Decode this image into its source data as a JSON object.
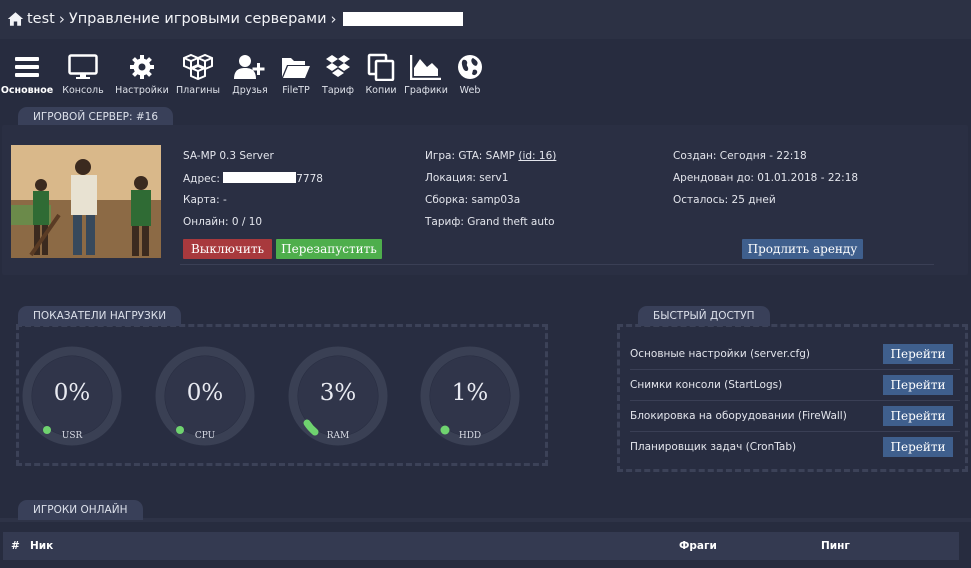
{
  "breadcrumb": {
    "root": "test",
    "section": "Управление игровыми серверами"
  },
  "toolbar": [
    {
      "label": "Основное",
      "icon": "menu-icon",
      "active": true
    },
    {
      "label": "Консоль",
      "icon": "monitor-icon"
    },
    {
      "label": "Настройки",
      "icon": "gear-icon"
    },
    {
      "label": "Плагины",
      "icon": "cubes-icon"
    },
    {
      "label": "Друзья",
      "icon": "add-user-icon"
    },
    {
      "label": "FileTP",
      "icon": "folder-icon"
    },
    {
      "label": "Тариф",
      "icon": "dropbox-icon"
    },
    {
      "label": "Копии",
      "icon": "copy-icon"
    },
    {
      "label": "Графики",
      "icon": "area-chart-icon"
    },
    {
      "label": "Web",
      "icon": "globe-icon"
    }
  ],
  "server": {
    "tab": "ИГРОВОЙ СЕРВЕР: #16",
    "name": "SA-MP 0.3 Server",
    "address_label": "Адрес:",
    "address_suffix": "7778",
    "map": "Карта: -",
    "online": "Онлайн: 0 / 10",
    "game_prefix": "Игра: GTA: SAMP",
    "game_id": "(id: 16)",
    "location": "Локация: serv1",
    "build": "Сборка: samp03a",
    "tariff": "Тариф: Grand theft auto",
    "created": "Создан: Сегодня - 22:18",
    "rented_until": "Арендован до: 01.01.2018 - 22:18",
    "remaining": "Осталось: 25 дней",
    "btn_stop": "Выключить",
    "btn_restart": "Перезапустить",
    "btn_extend": "Продлить аренду"
  },
  "load": {
    "tab": "ПОКАЗАТЕЛИ НАГРУЗКИ",
    "gauges": [
      {
        "label": "USR",
        "value": "0%",
        "percent": 0
      },
      {
        "label": "CPU",
        "value": "0%",
        "percent": 0
      },
      {
        "label": "RAM",
        "value": "3%",
        "percent": 3
      },
      {
        "label": "HDD",
        "value": "1%",
        "percent": 1
      }
    ]
  },
  "quick": {
    "tab": "БЫСТРЫЙ ДОСТУП",
    "button_label": "Перейти",
    "items": [
      "Основные настройки (server.cfg)",
      "Снимки консоли (StartLogs)",
      "Блокировка на оборудовании (FireWall)",
      "Планировщик задач (CronTab)"
    ]
  },
  "players": {
    "tab": "ИГРОКИ ОНЛАЙН",
    "columns": [
      "#",
      "Ник",
      "Фраги",
      "Пинг"
    ]
  },
  "colors": {
    "background": "#272c3f",
    "stop": "#a8393d",
    "restart": "#4eae4c",
    "primary": "#3f5f8d",
    "gauge_dot": "#6fd36f"
  }
}
